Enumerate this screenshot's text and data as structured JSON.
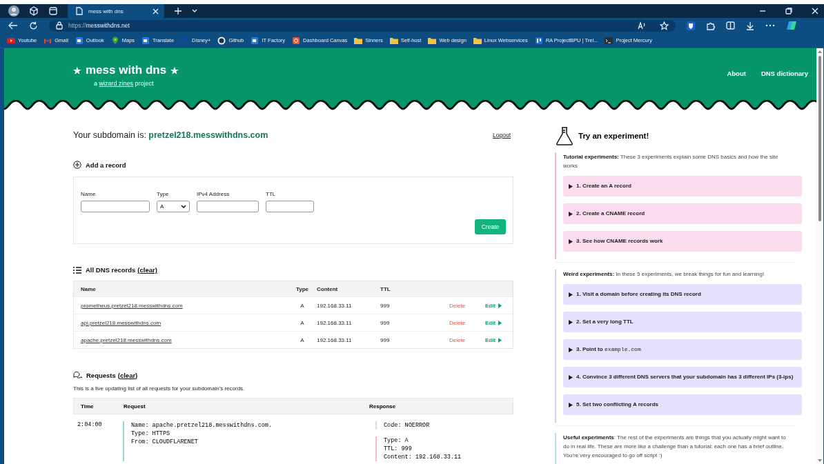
{
  "browser": {
    "tabs": [
      {
        "title": "mess with dns",
        "selected": true
      }
    ],
    "url_scheme": "https://",
    "url_host": "messwithdns.net",
    "bookmarks": [
      {
        "label": "Youtube",
        "kind": "video"
      },
      {
        "label": "Gmail",
        "kind": "mail"
      },
      {
        "label": "Outlook",
        "kind": "square"
      },
      {
        "label": "Maps",
        "kind": "pin"
      },
      {
        "label": "Translate",
        "kind": "square"
      },
      {
        "label": "Disney+",
        "kind": "arc"
      },
      {
        "label": "Github",
        "kind": "circle"
      },
      {
        "label": "IT Factory",
        "kind": "square"
      },
      {
        "label": "Dashboard Canvas",
        "kind": "orange"
      },
      {
        "label": "Sinners",
        "kind": "folder"
      },
      {
        "label": "Self-host",
        "kind": "folder"
      },
      {
        "label": "Web design",
        "kind": "folder"
      },
      {
        "label": "Linux Webservices",
        "kind": "folder"
      },
      {
        "label": "RA ProjectBPU | Trel...",
        "kind": "board"
      },
      {
        "label": "Project Mercury",
        "kind": "terminal"
      }
    ]
  },
  "header": {
    "star_left": "★",
    "title": "mess with dns",
    "star_right": "★",
    "tagline_before": "a",
    "tagline_link": "wizard zines",
    "tagline_after": "project",
    "nav": [
      "About",
      "DNS dictionary"
    ]
  },
  "subdomain": {
    "label": "Your subdomain is:",
    "value": "pretzel218.messwithdns.com",
    "logout": "Logout"
  },
  "add_record": {
    "title": "Add a record",
    "fields": [
      {
        "label": "Name",
        "kind": "text"
      },
      {
        "label": "Type",
        "kind": "select",
        "value": "A"
      },
      {
        "label": "IPv4 Address",
        "kind": "text"
      },
      {
        "label": "TTL",
        "kind": "text"
      }
    ],
    "button": "Create"
  },
  "records": {
    "title": "All DNS records",
    "clear": "(clear)",
    "columns": [
      "Name",
      "Type",
      "Content",
      "TTL"
    ],
    "rows": [
      {
        "name": "prometheus.pretzel218.messwithdns.com",
        "type": "A",
        "content": "192.168.33.11",
        "ttl": "999",
        "delete": "Delete",
        "edit": "Edit"
      },
      {
        "name": "api.pretzel218.messwithdns.com",
        "type": "A",
        "content": "192.168.33.11",
        "ttl": "999",
        "delete": "Delete",
        "edit": "Edit"
      },
      {
        "name": "apache.pretzel218.messwithdns.com",
        "type": "A",
        "content": "192.168.33.11",
        "ttl": "999",
        "delete": "Delete",
        "edit": "Edit"
      }
    ]
  },
  "requests": {
    "title": "Requests",
    "clear": "(clear)",
    "description": "This is a live updating list of all requests for your subdomain's records.",
    "columns": [
      "Time",
      "Request",
      "Response"
    ],
    "rows": [
      {
        "time": "2:04:00",
        "request": [
          "Name: apache.pretzel218.messwithdns.com.",
          "Type: HTTPS",
          "From: CLOUDFLARENET"
        ],
        "code": "Code: NOERROR",
        "answer": [
          "Type: A",
          "TTL: 999",
          "Content: 192.168.33.11"
        ]
      }
    ]
  },
  "experiments": {
    "title": "Try an experiment!",
    "groups": [
      {
        "kind": "tutorial",
        "intro": "**Tutorial experiments:** These 3 experiments explain some DNS basics and how the site works",
        "items": [
          {
            "label": "1. Create an A record",
            "expanded": false
          },
          {
            "label": "2. Create a CNAME record",
            "expanded": false
          },
          {
            "label": "3. See how CNAME records work",
            "expanded": false
          }
        ]
      },
      {
        "kind": "weird",
        "intro": "**Weird experiments:** In these 5 experiments, we break things for fun and learning!",
        "items": [
          {
            "label": "1. Visit a domain before creating its DNS record",
            "expanded": false
          },
          {
            "label": "2. Set a very long TTL",
            "expanded": false
          },
          {
            "label": "3. Point to",
            "code": "example.com",
            "expanded": false
          },
          {
            "label": "4. Convince 3 different DNS servers that your subdomain has 3 different IPs (3-ips)",
            "expanded": false
          },
          {
            "label": "5. Set two conflicting A records",
            "expanded": false
          }
        ]
      },
      {
        "kind": "useful",
        "intro": "**Useful experiments**: The rest of the experiments are things that you actually might want to do in real life. These are more like a challenge than a tutorial: each one has a brief outline. You're very encouraged to go off script :)"
      }
    ]
  }
}
